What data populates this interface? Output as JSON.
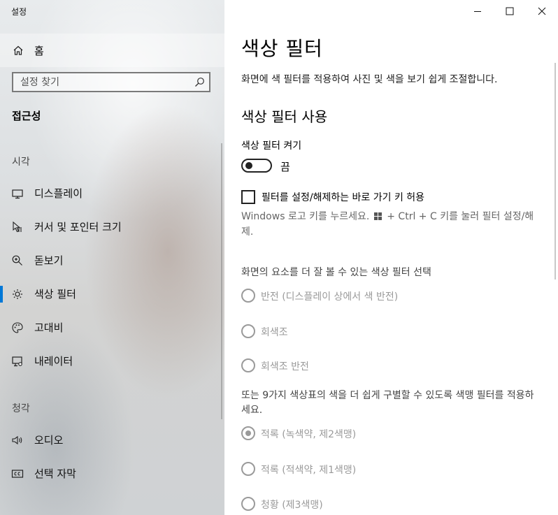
{
  "window": {
    "title": "설정"
  },
  "sidebar": {
    "home_label": "홈",
    "search_placeholder": "설정 찾기",
    "current_section": "접근성",
    "groups": [
      {
        "header": "시각",
        "items": [
          {
            "label": "디스플레이",
            "icon": "monitor-icon"
          },
          {
            "label": "커서 및 포인터 크기",
            "icon": "cursor-icon"
          },
          {
            "label": "돋보기",
            "icon": "magnifier-icon"
          },
          {
            "label": "색상 필터",
            "icon": "brightness-icon",
            "active": true
          },
          {
            "label": "고대비",
            "icon": "palette-icon"
          },
          {
            "label": "내레이터",
            "icon": "narrator-icon"
          }
        ]
      },
      {
        "header": "청각",
        "items": [
          {
            "label": "오디오",
            "icon": "speaker-icon"
          },
          {
            "label": "선택 자막",
            "icon": "closed-caption-icon"
          }
        ]
      }
    ]
  },
  "main": {
    "title": "색상 필터",
    "description": "화면에 색 필터를 적용하여 사진 및 색을 보기 쉽게 조절합니다.",
    "section_title": "색상 필터 사용",
    "toggle": {
      "label": "색상 필터 켜기",
      "state_text": "끔",
      "on": false
    },
    "shortcut": {
      "label": "필터를 설정/해제하는 바로 가기 키 허용",
      "checked": false,
      "hint_before": "Windows 로고 키를 누르세요.",
      "hint_after": "+ Ctrl + C 키를 눌러 필터 설정/해제."
    },
    "filter_header": "화면의 요소를 더 잘 볼 수 있는 색상 필터 선택",
    "filters": [
      {
        "label": "반전",
        "note": "(디스플레이 상에서 색 반전)",
        "checked": false
      },
      {
        "label": "회색조",
        "note": "",
        "checked": false
      },
      {
        "label": "회색조 반전",
        "note": "",
        "checked": false
      }
    ],
    "colorblind_header": "또는 9가지 색상표의 색을 더 쉽게 구별할 수 있도록 색맹 필터를 적용하세요.",
    "colorblind_filters": [
      {
        "label": "적록",
        "note": "(녹색약, 제2색맹)",
        "checked": true
      },
      {
        "label": "적록",
        "note": "(적색약, 제1색맹)",
        "checked": false
      },
      {
        "label": "청황",
        "note": "(제3색맹)",
        "checked": false
      }
    ]
  },
  "colors": {
    "accent": "#0078d7",
    "disabled": "#9a9a9a"
  }
}
